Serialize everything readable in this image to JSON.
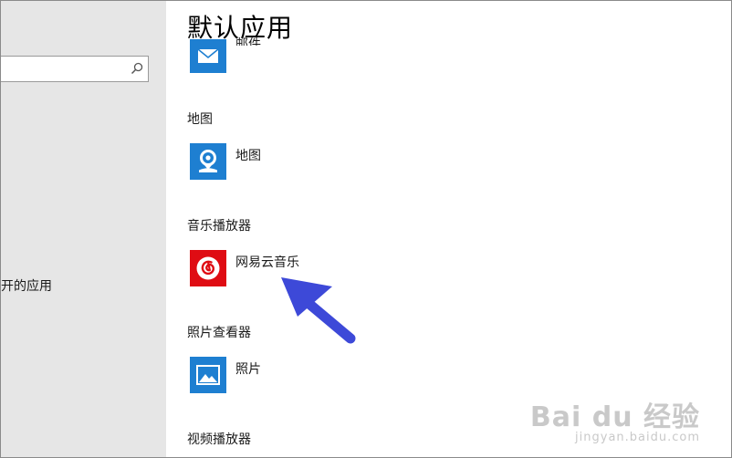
{
  "page": {
    "title": "默认应用"
  },
  "sidebar": {
    "search_value": "",
    "item_label": "开的应用"
  },
  "mail": {
    "app_name": "邮件"
  },
  "sections": {
    "maps": {
      "label": "地图",
      "app_name": "地图"
    },
    "music": {
      "label": "音乐播放器",
      "app_name": "网易云音乐"
    },
    "photos": {
      "label": "照片查看器",
      "app_name": "照片"
    },
    "video": {
      "label": "视频播放器"
    }
  },
  "colors": {
    "tile_blue": "#1e7fd1",
    "tile_red": "#df0c13",
    "arrow": "#3d49d8"
  },
  "watermark": {
    "line1": "Bai du 经验",
    "line2": "jingyan.baidu.com"
  }
}
